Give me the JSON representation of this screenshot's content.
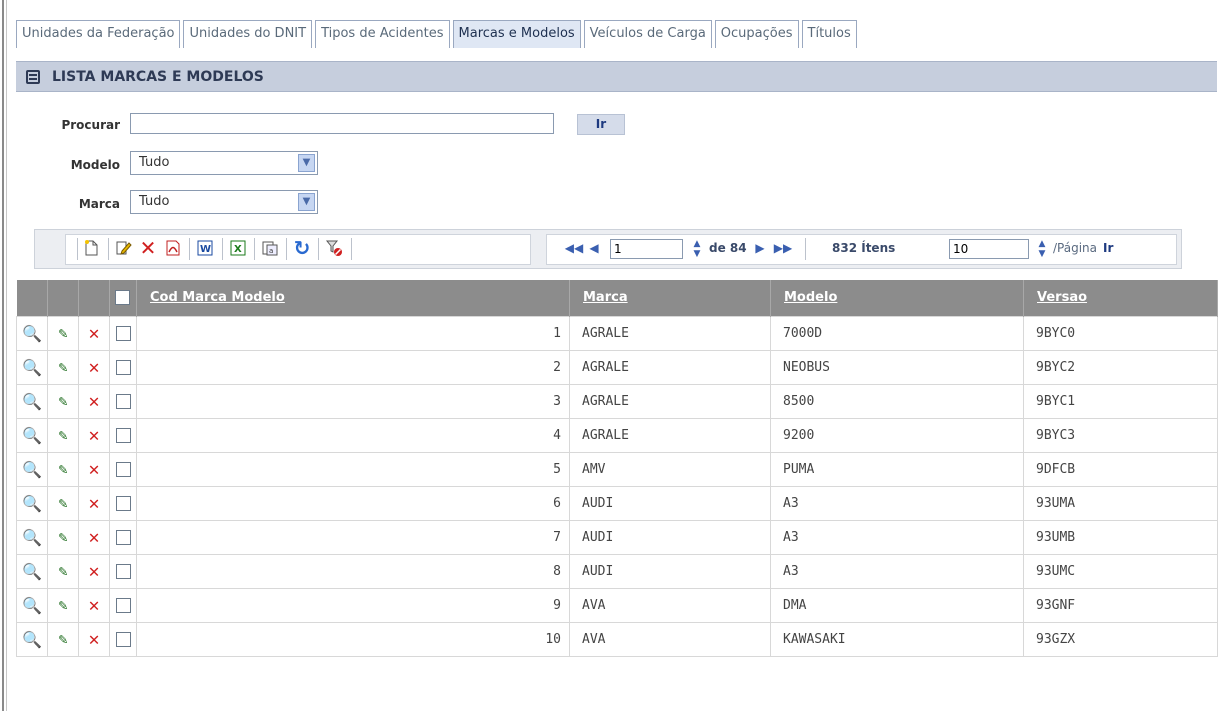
{
  "tabs": [
    {
      "label": "Unidades da Federação"
    },
    {
      "label": "Unidades do DNIT"
    },
    {
      "label": "Tipos de Acidentes"
    },
    {
      "label": "Marcas e Modelos"
    },
    {
      "label": "Veículos de Carga"
    },
    {
      "label": "Ocupações"
    },
    {
      "label": "Títulos"
    }
  ],
  "active_tab": "Marcas e Modelos",
  "panel": {
    "title": "LISTA MARCAS E MODELOS"
  },
  "search": {
    "label": "Procurar",
    "value": "",
    "button": "Ir"
  },
  "filters": {
    "modelo": {
      "label": "Modelo",
      "value": "Tudo"
    },
    "marca": {
      "label": "Marca",
      "value": "Tudo"
    }
  },
  "pager": {
    "page": "1",
    "of_label": "de 84",
    "items_label": "832 Ítens",
    "per_page": "10",
    "per_page_label": "/Página",
    "go": "Ir"
  },
  "grid": {
    "columns": {
      "cod": "Cod Marca Modelo",
      "marca": "Marca",
      "modelo": "Modelo",
      "versao": "Versao"
    },
    "rows": [
      {
        "cod": "1",
        "marca": "AGRALE",
        "modelo": "7000D",
        "versao": "9BYC0"
      },
      {
        "cod": "2",
        "marca": "AGRALE",
        "modelo": "NEOBUS",
        "versao": "9BYC2"
      },
      {
        "cod": "3",
        "marca": "AGRALE",
        "modelo": "8500",
        "versao": "9BYC1"
      },
      {
        "cod": "4",
        "marca": "AGRALE",
        "modelo": "9200",
        "versao": "9BYC3"
      },
      {
        "cod": "5",
        "marca": "AMV",
        "modelo": "PUMA",
        "versao": "9DFCB"
      },
      {
        "cod": "6",
        "marca": "AUDI",
        "modelo": "A3",
        "versao": "93UMA"
      },
      {
        "cod": "7",
        "marca": "AUDI",
        "modelo": "A3",
        "versao": "93UMB"
      },
      {
        "cod": "8",
        "marca": "AUDI",
        "modelo": "A3",
        "versao": "93UMC"
      },
      {
        "cod": "9",
        "marca": "AVA",
        "modelo": "DMA",
        "versao": "93GNF"
      },
      {
        "cod": "10",
        "marca": "AVA",
        "modelo": "KAWASAKI",
        "versao": "93GZX"
      }
    ]
  },
  "icons": {
    "view": "magnifier-icon",
    "edit": "edit-icon",
    "delete": "delete-icon",
    "new": "new-document-icon",
    "pdf": "pdf-icon",
    "word": "word-icon",
    "excel": "excel-icon",
    "copy": "copy-icon",
    "refresh": "refresh-icon",
    "filter_clear": "clear-filter-icon",
    "first": "first-page-icon",
    "prev": "previous-page-icon",
    "next": "next-page-icon",
    "last": "last-page-icon"
  },
  "colors": {
    "header_bg": "#c6cedd",
    "grid_header_bg": "#8c8c8c",
    "active_tab_bg": "#dfe7f4",
    "delete_red": "#d02020"
  }
}
